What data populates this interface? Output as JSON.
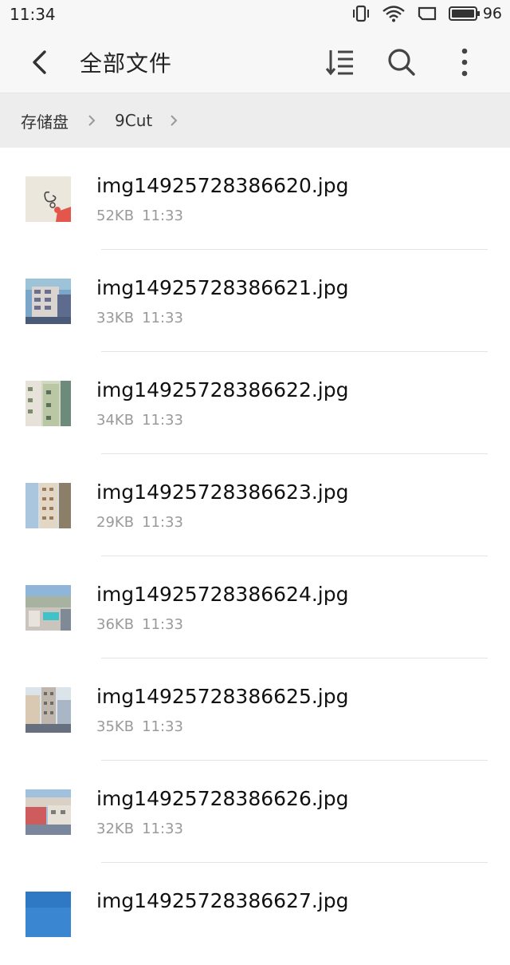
{
  "status_bar": {
    "time": "11:34",
    "battery": "96"
  },
  "app_bar": {
    "title": "全部文件"
  },
  "breadcrumb": {
    "items": [
      "存储盘",
      "9Cut"
    ]
  },
  "files": [
    {
      "name": "img14925728386620.jpg",
      "size": "52KB",
      "time": "11:33",
      "thumb": "sketch"
    },
    {
      "name": "img14925728386621.jpg",
      "size": "33KB",
      "time": "11:33",
      "thumb": "building-blue"
    },
    {
      "name": "img14925728386622.jpg",
      "size": "34KB",
      "time": "11:33",
      "thumb": "building-green"
    },
    {
      "name": "img14925728386623.jpg",
      "size": "29KB",
      "time": "11:33",
      "thumb": "building-tall"
    },
    {
      "name": "img14925728386624.jpg",
      "size": "36KB",
      "time": "11:33",
      "thumb": "city-pool"
    },
    {
      "name": "img14925728386625.jpg",
      "size": "35KB",
      "time": "11:33",
      "thumb": "city-tower"
    },
    {
      "name": "img14925728386626.jpg",
      "size": "32KB",
      "time": "11:33",
      "thumb": "city-red"
    },
    {
      "name": "img14925728386627.jpg",
      "size": "",
      "time": "",
      "thumb": "sky"
    }
  ]
}
